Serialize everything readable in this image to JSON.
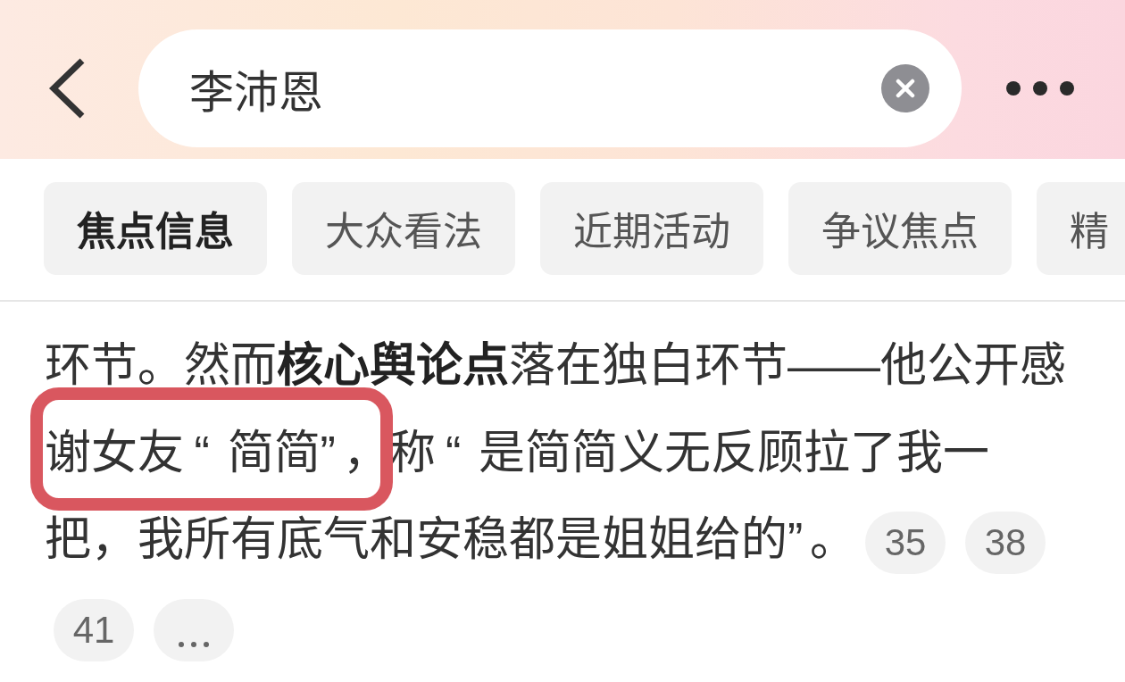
{
  "search": {
    "value": "李沛恩"
  },
  "tabs": [
    {
      "label": "焦点信息",
      "selected": true
    },
    {
      "label": "大众看法",
      "selected": false
    },
    {
      "label": "近期活动",
      "selected": false
    },
    {
      "label": "争议焦点",
      "selected": false
    },
    {
      "label": "精",
      "selected": false
    }
  ],
  "article": {
    "text": "环节。然而**核心舆论点**落在独白环节——他公开感谢女友“简简”，称“是简简义无反顾拉了我一把，我所有底气和安稳都是姐姐给的”。",
    "highlight_frame": true,
    "citations": [
      {
        "kind": "number",
        "label": "35"
      },
      {
        "kind": "number",
        "label": "38"
      },
      {
        "kind": "number",
        "label": "41"
      },
      {
        "kind": "more"
      }
    ]
  }
}
